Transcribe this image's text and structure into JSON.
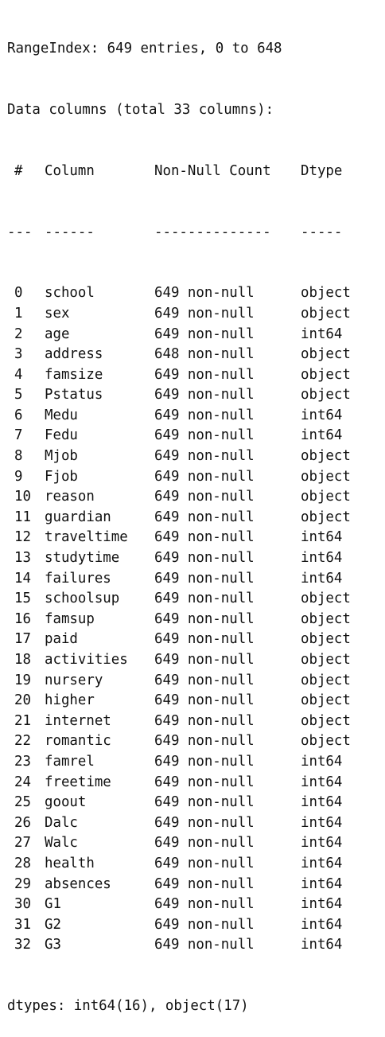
{
  "summary": {
    "range_index": "RangeIndex: 649 entries, 0 to 648",
    "data_columns": "Data columns (total 33 columns):"
  },
  "header": {
    "idx": "#",
    "column": "Column",
    "count": "Non-Null Count",
    "dtype": "Dtype"
  },
  "separator": {
    "idx": "---",
    "column": "------",
    "count": "--------------",
    "dtype": "-----"
  },
  "rows": [
    {
      "idx": "0",
      "column": "school",
      "count": "649 non-null",
      "dtype": "object"
    },
    {
      "idx": "1",
      "column": "sex",
      "count": "649 non-null",
      "dtype": "object"
    },
    {
      "idx": "2",
      "column": "age",
      "count": "649 non-null",
      "dtype": "int64"
    },
    {
      "idx": "3",
      "column": "address",
      "count": "648 non-null",
      "dtype": "object"
    },
    {
      "idx": "4",
      "column": "famsize",
      "count": "649 non-null",
      "dtype": "object"
    },
    {
      "idx": "5",
      "column": "Pstatus",
      "count": "649 non-null",
      "dtype": "object"
    },
    {
      "idx": "6",
      "column": "Medu",
      "count": "649 non-null",
      "dtype": "int64"
    },
    {
      "idx": "7",
      "column": "Fedu",
      "count": "649 non-null",
      "dtype": "int64"
    },
    {
      "idx": "8",
      "column": "Mjob",
      "count": "649 non-null",
      "dtype": "object"
    },
    {
      "idx": "9",
      "column": "Fjob",
      "count": "649 non-null",
      "dtype": "object"
    },
    {
      "idx": "10",
      "column": "reason",
      "count": "649 non-null",
      "dtype": "object"
    },
    {
      "idx": "11",
      "column": "guardian",
      "count": "649 non-null",
      "dtype": "object"
    },
    {
      "idx": "12",
      "column": "traveltime",
      "count": "649 non-null",
      "dtype": "int64"
    },
    {
      "idx": "13",
      "column": "studytime",
      "count": "649 non-null",
      "dtype": "int64"
    },
    {
      "idx": "14",
      "column": "failures",
      "count": "649 non-null",
      "dtype": "int64"
    },
    {
      "idx": "15",
      "column": "schoolsup",
      "count": "649 non-null",
      "dtype": "object"
    },
    {
      "idx": "16",
      "column": "famsup",
      "count": "649 non-null",
      "dtype": "object"
    },
    {
      "idx": "17",
      "column": "paid",
      "count": "649 non-null",
      "dtype": "object"
    },
    {
      "idx": "18",
      "column": "activities",
      "count": "649 non-null",
      "dtype": "object"
    },
    {
      "idx": "19",
      "column": "nursery",
      "count": "649 non-null",
      "dtype": "object"
    },
    {
      "idx": "20",
      "column": "higher",
      "count": "649 non-null",
      "dtype": "object"
    },
    {
      "idx": "21",
      "column": "internet",
      "count": "649 non-null",
      "dtype": "object"
    },
    {
      "idx": "22",
      "column": "romantic",
      "count": "649 non-null",
      "dtype": "object"
    },
    {
      "idx": "23",
      "column": "famrel",
      "count": "649 non-null",
      "dtype": "int64"
    },
    {
      "idx": "24",
      "column": "freetime",
      "count": "649 non-null",
      "dtype": "int64"
    },
    {
      "idx": "25",
      "column": "goout",
      "count": "649 non-null",
      "dtype": "int64"
    },
    {
      "idx": "26",
      "column": "Dalc",
      "count": "649 non-null",
      "dtype": "int64"
    },
    {
      "idx": "27",
      "column": "Walc",
      "count": "649 non-null",
      "dtype": "int64"
    },
    {
      "idx": "28",
      "column": "health",
      "count": "649 non-null",
      "dtype": "int64"
    },
    {
      "idx": "29",
      "column": "absences",
      "count": "649 non-null",
      "dtype": "int64"
    },
    {
      "idx": "30",
      "column": "G1",
      "count": "649 non-null",
      "dtype": "int64"
    },
    {
      "idx": "31",
      "column": "G2",
      "count": "649 non-null",
      "dtype": "int64"
    },
    {
      "idx": "32",
      "column": "G3",
      "count": "649 non-null",
      "dtype": "int64"
    }
  ],
  "footer": {
    "dtypes": "dtypes: int64(16), object(17)"
  }
}
